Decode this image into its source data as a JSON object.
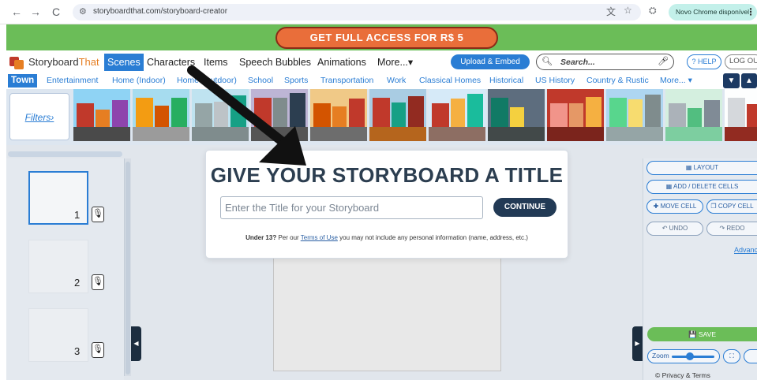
{
  "browser": {
    "back_icon": "←",
    "forward_icon": "→",
    "reload_icon": "C",
    "url": "storyboardthat.com/storyboard-creator",
    "update_label": "Novo Chrome disponível"
  },
  "promo": {
    "label": "GET FULL ACCESS FOR R$ 5",
    "bg_color": "#6bbd58",
    "button_color": "#e96e3a"
  },
  "nav": {
    "logo_part1": "Storyboard",
    "logo_part2": "That",
    "tabs": [
      "Scenes",
      "Characters",
      "Items",
      "Speech Bubbles",
      "Animations",
      "More...▾"
    ],
    "active_tab": "Scenes",
    "upload_label": "Upload & Embed",
    "search_placeholder": "Search...",
    "help_label": "? HELP",
    "logout_label": "LOG OUT"
  },
  "categories": {
    "active": "Town",
    "items": [
      "Town",
      "Entertainment",
      "Home (Indoor)",
      "Home (Outdoor)",
      "School",
      "Sports",
      "Transportation",
      "Work",
      "Classical Homes",
      "Historical",
      "US History",
      "Country & Rustic",
      "More... ▾"
    ]
  },
  "thumbnails": {
    "filters_label": "Filters›",
    "count": 12
  },
  "cells": {
    "items": [
      {
        "number": "1",
        "selected": true
      },
      {
        "number": "2",
        "selected": false
      },
      {
        "number": "3",
        "selected": false
      }
    ],
    "mic_icon": "🎙"
  },
  "tools": {
    "layout": "▦ LAYOUT",
    "add_delete": "▦ ADD / DELETE CELLS",
    "move_cell": "✚ MOVE CELL",
    "copy_cell": "❐ COPY CELL",
    "undo": "↶ UNDO",
    "redo": "↷ REDO",
    "advanced": "Advanced",
    "save": "💾 SAVE",
    "zoom_label": "Zoom",
    "zoom_level": 0.35,
    "privacy": "© Privacy & Terms"
  },
  "modal": {
    "title": "GIVE YOUR STORYBOARD A TITLE",
    "input_placeholder": "Enter the Title for your Storyboard",
    "input_value": "",
    "continue_label": "CONTINUE",
    "note_prefix": "Under 13?",
    "note_mid": " Per our ",
    "note_link": "Terms of Use",
    "note_suffix": " you may not include any personal information (name, address, etc.)"
  },
  "colors": {
    "accent": "#2a7dd4",
    "dark_button": "#223a55",
    "title_color": "#2c3e50"
  }
}
